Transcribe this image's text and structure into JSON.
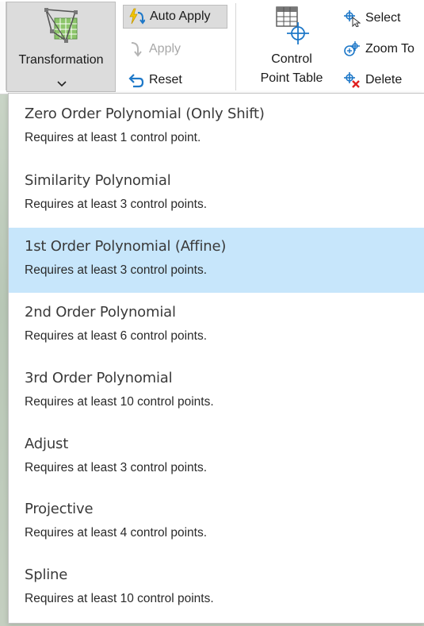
{
  "ribbon": {
    "transformation_label": "Transformation",
    "auto_apply_label": "Auto Apply",
    "apply_label": "Apply",
    "reset_label": "Reset",
    "control_point_table_line1": "Control",
    "control_point_table_line2": "Point Table",
    "select_label": "Select",
    "zoom_to_label": "Zoom To",
    "delete_label": "Delete"
  },
  "menu": {
    "selected_index": 2,
    "items": [
      {
        "title": "Zero Order Polynomial (Only Shift)",
        "subtitle": "Requires at least 1 control point."
      },
      {
        "title": "Similarity Polynomial",
        "subtitle": "Requires at least 3 control points."
      },
      {
        "title": "1st Order Polynomial (Affine)",
        "subtitle": "Requires at least 3 control points."
      },
      {
        "title": "2nd Order Polynomial",
        "subtitle": "Requires at least 6 control points."
      },
      {
        "title": "3rd Order Polynomial",
        "subtitle": "Requires at least 10 control points."
      },
      {
        "title": "Adjust",
        "subtitle": "Requires at least 3 control points."
      },
      {
        "title": "Projective",
        "subtitle": "Requires at least 4 control points."
      },
      {
        "title": "Spline",
        "subtitle": "Requires at least 10 control points."
      }
    ]
  },
  "colors": {
    "selected_item_bg": "#c7e6fb",
    "accent_blue": "#1e78c8",
    "lightning_yellow": "#f2c500",
    "delete_red": "#e02020"
  },
  "icons": {
    "transformation": "transformation-grid-icon",
    "auto_apply": "lightning-arrow-icon",
    "apply": "curved-arrow-icon",
    "reset": "undo-arrow-icon",
    "control_point_table": "table-crosshair-icon",
    "select": "crosshair-cursor-icon",
    "zoom_to": "zoom-crosshair-icon",
    "delete": "crosshair-delete-icon"
  }
}
